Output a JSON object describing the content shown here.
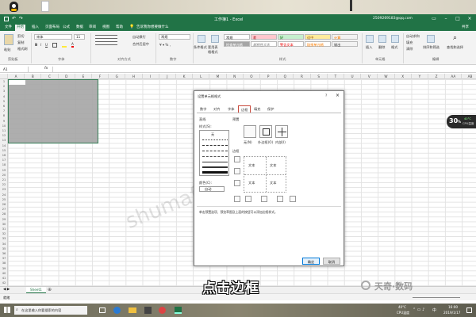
{
  "window": {
    "title": "工作簿1 - Excel",
    "account": "2509269183@qq.com"
  },
  "ribbon": {
    "tabs": [
      "文件",
      "开始",
      "插入",
      "页面布局",
      "公式",
      "数据",
      "审阅",
      "视图",
      "帮助"
    ],
    "active_tab": "开始",
    "tell_me": "告诉我你想要做什么",
    "share": "共享",
    "clipboard": {
      "cut": "剪切",
      "copy": "复制",
      "format_painter": "格式刷",
      "paste": "粘贴",
      "label": "剪贴板"
    },
    "font": {
      "name": "宋体",
      "size": "11",
      "label": "字体"
    },
    "alignment": {
      "wrap": "自动换行",
      "merge": "合并后居中",
      "label": "对齐方式"
    },
    "number": {
      "format": "常规",
      "label": "数字"
    },
    "styles": {
      "conditional": "条件格式",
      "table": "套用表格格式",
      "label": "样式",
      "cells_left": [
        "常规",
        "检查单元格"
      ],
      "cells": [
        "差",
        "好",
        "适中",
        "计算",
        "解释性文本",
        "警告文本",
        "链接单元格",
        "输出"
      ]
    },
    "cells_group": {
      "insert": "插入",
      "delete": "删除",
      "format": "格式",
      "label": "单元格"
    },
    "editing": {
      "autosum": "自动求和",
      "fill": "填充",
      "clear": "清除",
      "sort": "排序和筛选",
      "find": "查找和选择",
      "label": "编辑"
    }
  },
  "formula_bar": {
    "name_box": "A1",
    "fx": "fx"
  },
  "columns": [
    "A",
    "B",
    "C",
    "D",
    "E",
    "F",
    "G",
    "H",
    "I",
    "J",
    "K",
    "L",
    "M",
    "N",
    "O",
    "P",
    "Q",
    "R",
    "S",
    "T",
    "U",
    "V",
    "W",
    "X",
    "Y",
    "Z",
    "AA",
    "AB"
  ],
  "rows": [
    "1",
    "2",
    "3",
    "4",
    "5",
    "6",
    "7",
    "8",
    "9",
    "10",
    "11",
    "12",
    "13",
    "14",
    "15",
    "16",
    "17",
    "18",
    "19",
    "20",
    "21",
    "22",
    "23",
    "24",
    "25",
    "26",
    "27",
    "28",
    "29",
    "30",
    "31",
    "32",
    "33",
    "34",
    "35",
    "36",
    "37",
    "38",
    "39",
    "40",
    "41",
    "42"
  ],
  "sheet": {
    "tab": "Sheet1",
    "status": "就绪"
  },
  "dialog": {
    "title": "设置单元格格式",
    "help": "?",
    "close": "×",
    "tabs": [
      "数字",
      "对齐",
      "字体",
      "边框",
      "填充",
      "保护"
    ],
    "active_tab": "边框",
    "line_section": "直线",
    "style_label": "样式(S):",
    "none_label": "无",
    "color_label": "颜色(C):",
    "color_value": "自动",
    "presets_label": "预置",
    "presets": [
      "无(N)",
      "外边框(O)",
      "内部(I)"
    ],
    "border_label": "边框",
    "preview_texts": [
      "文本",
      "文本",
      "文本",
      "文本"
    ],
    "hint": "单击预置选项、预览草图及上面的按钮可以添加边框样式。",
    "ok": "确定",
    "cancel": "取消"
  },
  "caption": "点击边框",
  "watermark": "shumaflanqiyun.com",
  "logo": "天奇·数码",
  "badge": {
    "value": "30",
    "unit": "%",
    "line1": "40°C",
    "line2": "CPU温度"
  },
  "taskbar": {
    "search_placeholder": "在这里输入你要搜索的内容",
    "temp": "40°C",
    "cpu": "CPU温度",
    "lang": "中",
    "time": "16:00",
    "date": "2019/1/17"
  }
}
